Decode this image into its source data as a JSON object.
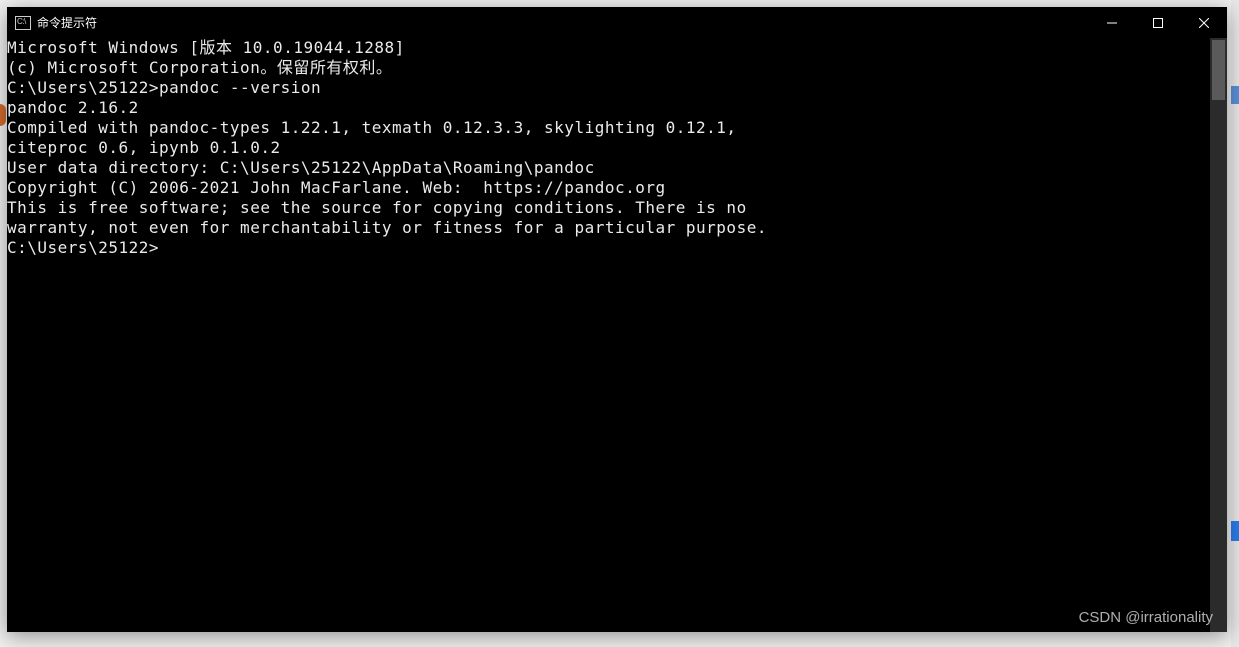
{
  "window": {
    "title": "命令提示符",
    "icon_label": "C:\\"
  },
  "terminal": {
    "lines": [
      "Microsoft Windows [版本 10.0.19044.1288]",
      "(c) Microsoft Corporation。保留所有权利。",
      "",
      "C:\\Users\\25122>pandoc --version",
      "pandoc 2.16.2",
      "Compiled with pandoc-types 1.22.1, texmath 0.12.3.3, skylighting 0.12.1,",
      "citeproc 0.6, ipynb 0.1.0.2",
      "User data directory: C:\\Users\\25122\\AppData\\Roaming\\pandoc",
      "Copyright (C) 2006-2021 John MacFarlane. Web:  https://pandoc.org",
      "This is free software; see the source for copying conditions. There is no",
      "warranty, not even for merchantability or fitness for a particular purpose.",
      "",
      "C:\\Users\\25122>"
    ]
  },
  "watermark": "CSDN @irrationality"
}
